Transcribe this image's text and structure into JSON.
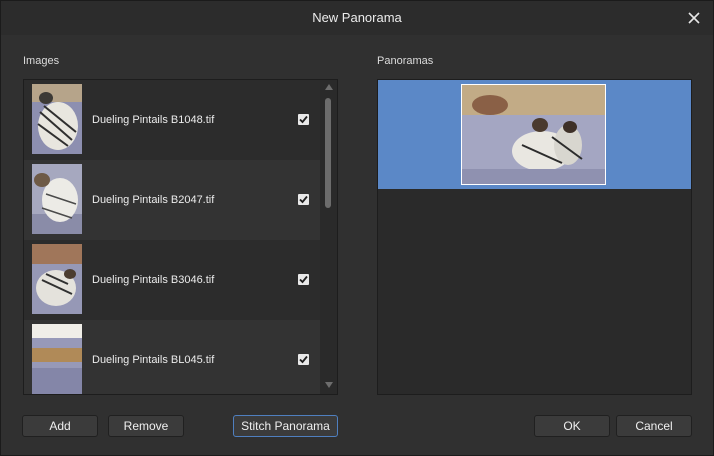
{
  "window": {
    "title": "New Panorama"
  },
  "images": {
    "label": "Images",
    "items": [
      {
        "filename": "Dueling Pintails B1048.tif",
        "checked": true
      },
      {
        "filename": "Dueling Pintails B2047.tif",
        "checked": true
      },
      {
        "filename": "Dueling Pintails B3046.tif",
        "checked": true
      },
      {
        "filename": "Dueling Pintails BL045.tif",
        "checked": true
      }
    ]
  },
  "panoramas": {
    "label": "Panoramas",
    "selected_index": 0
  },
  "buttons": {
    "add": "Add",
    "remove": "Remove",
    "stitch": "Stitch Panorama",
    "ok": "OK",
    "cancel": "Cancel"
  },
  "colors": {
    "selection": "#5b88c7",
    "accent_border": "#4f7fbf"
  },
  "icons": {
    "close": "close-icon",
    "check": "checkmark-icon",
    "scroll_up": "arrow-up-icon",
    "scroll_down": "arrow-down-icon"
  }
}
